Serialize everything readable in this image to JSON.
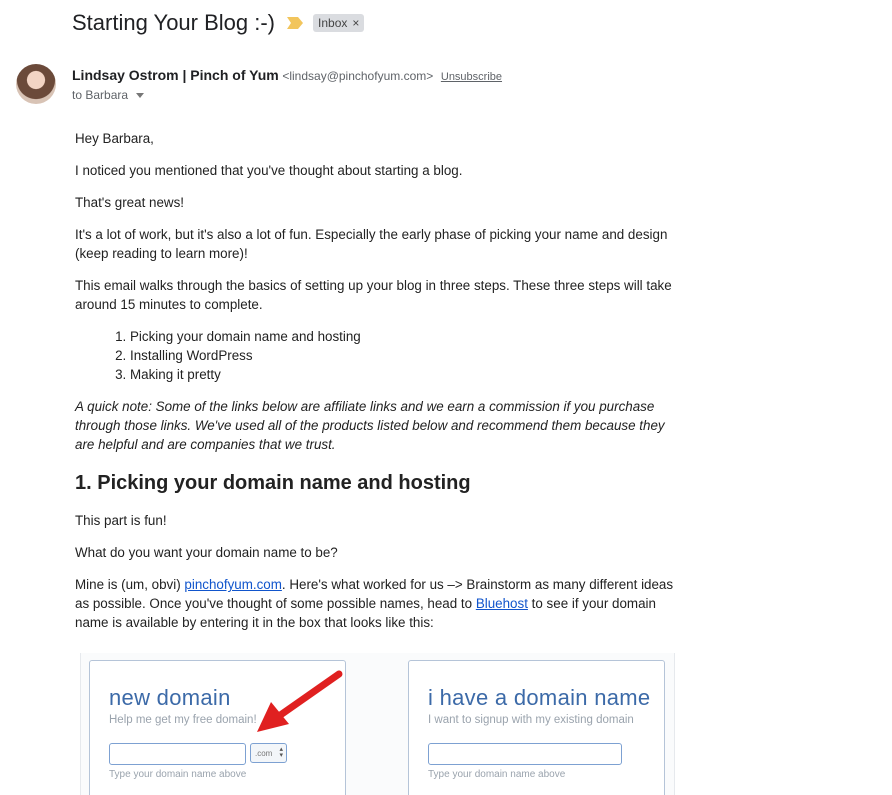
{
  "email": {
    "subject": "Starting Your Blog :-)",
    "label": "Inbox",
    "label_remove": "×",
    "sender_name": "Lindsay Ostrom | Pinch of Yum",
    "sender_email": "<lindsay@pinchofyum.com>",
    "unsubscribe": "Unsubscribe",
    "to": "to Barbara"
  },
  "body": {
    "greeting": "Hey Barbara,",
    "p1": "I noticed you mentioned that you've thought about starting a blog.",
    "p2": "That's great news!",
    "p3": "It's a lot of work, but it's also a lot of fun. Especially the early phase of picking your name and design (keep reading to learn more)!",
    "p4": "This email walks through the basics of setting up your blog in three steps. These three steps will take around 15 minutes to complete.",
    "steps": [
      "Picking your domain name and hosting",
      "Installing WordPress",
      "Making it pretty"
    ],
    "note": "A quick note: Some of the links below are affiliate links and we earn a commission if you purchase through those links. We've used all of the products listed below and recommend them because they are helpful and are companies that we trust.",
    "heading1": "1. Picking your domain name and hosting",
    "p5": "This part is fun!",
    "p6": "What do you want your domain name to be?",
    "p7_a": "Mine is (um, obvi) ",
    "p7_link1": "pinchofyum.com",
    "p7_b": ". Here's what worked for us –> Brainstorm as many different ideas as possible. Once you've thought of some possible names, head to ",
    "p7_link2": "Bluehost",
    "p7_c": " to see if your domain name is available by entering it in the box that looks like this:"
  },
  "embedded_image": {
    "new_domain": {
      "title": "new domain",
      "subtitle": "Help me get my free domain!",
      "tld": ".com",
      "hint": "Type your domain name above"
    },
    "existing_domain": {
      "title": "i have a domain name",
      "subtitle": "I want to signup with my existing domain",
      "hint": "Type your domain name above"
    }
  },
  "colors": {
    "link": "#1155cc",
    "importance_marker": "#f2c55c",
    "card_title": "#3c6aa8",
    "arrow": "#e02020"
  }
}
